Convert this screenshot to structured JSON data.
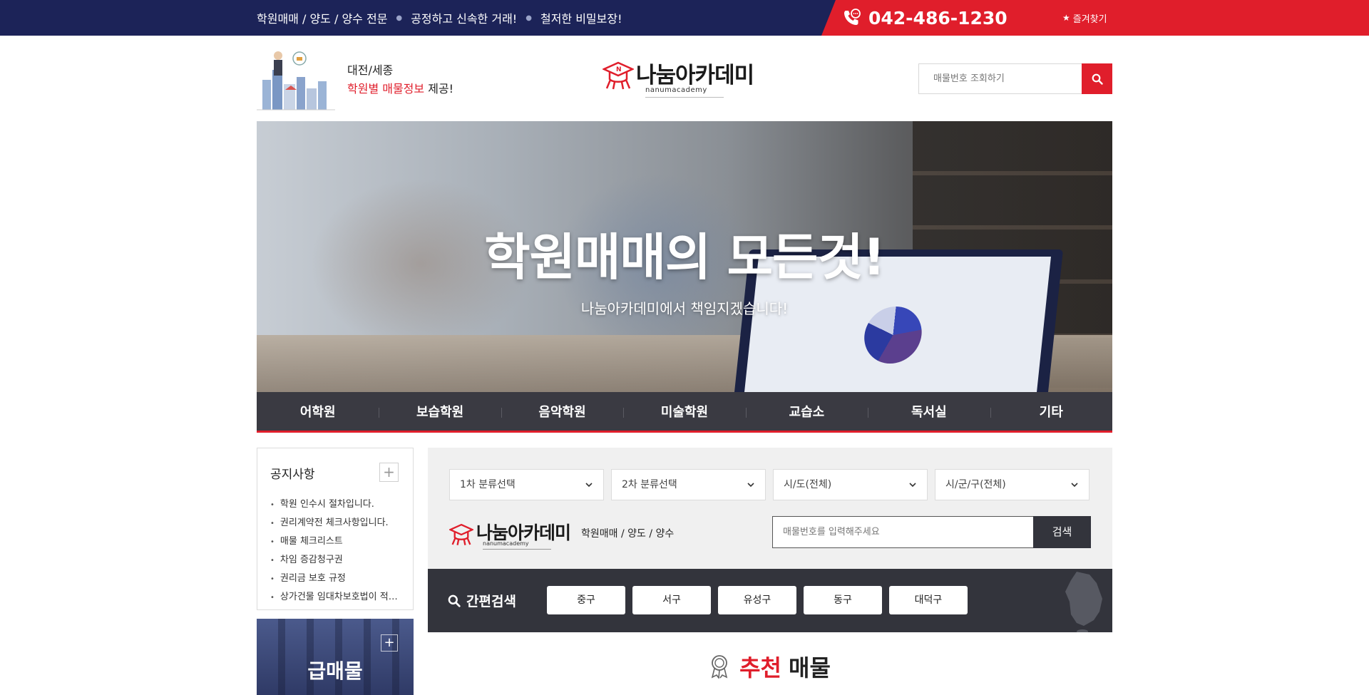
{
  "topbar": {
    "messages": [
      "학원매매 / 양도 / 양수 전문",
      "공정하고 신속한 거래!",
      "철저한 비밀보장!"
    ],
    "phone": "042-486-1230",
    "favorite_label": "즐겨찾기",
    "colors": {
      "navy": "#1c2358",
      "red": "#e01e2b"
    }
  },
  "header": {
    "promo_line1": "대전/세종",
    "promo_highlight": "학원별 매물정보",
    "promo_rest": " 제공!",
    "logo_name": "나눔아카데미",
    "logo_sub": "nanumacademy",
    "search_placeholder": "매물번호 조회하기"
  },
  "hero": {
    "title": "학원매매의 모든것!",
    "subtitle": "나눔아카데미에서 책임지겠습니다!"
  },
  "categories": [
    "어학원",
    "보습학원",
    "음악학원",
    "미술학원",
    "교습소",
    "독서실",
    "기타"
  ],
  "notice": {
    "title": "공지사항",
    "items": [
      "학원 인수시 절차입니다.",
      "권리계약전 체크사항입니다.",
      "매물 체크리스트",
      "차임 증감청구권",
      "권리금 보호 규정",
      "상가건물 임대차보호법이 적용되는 범위"
    ]
  },
  "urgent": {
    "label": "급매물"
  },
  "search_panel": {
    "selects": [
      "1차 분류선택",
      "2차 분류선택",
      "시/도(전체)",
      "시/군/구(전체)"
    ],
    "logo_name": "나눔아카데미",
    "logo_sub": "nanumacademy",
    "description": "학원매매 / 양도 / 양수",
    "input_placeholder": "매물번호를 입력해주세요",
    "search_button": "검색"
  },
  "quick_search": {
    "label": "간편검색",
    "districts": [
      "중구",
      "서구",
      "유성구",
      "동구",
      "대덕구"
    ]
  },
  "recommended": {
    "highlight": "추천",
    "rest": "매물"
  }
}
